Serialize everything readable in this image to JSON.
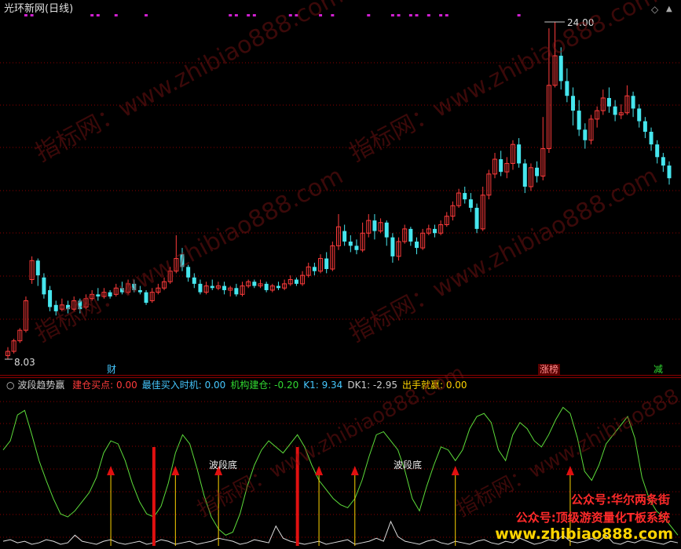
{
  "chart": {
    "title": "光环新网(日线)",
    "price_high_label": "24.00",
    "price_low_label": "8.03",
    "markers": {
      "cai": "财",
      "zhangbang": "涨榜",
      "jian": "减"
    },
    "icons": {
      "diamond": "◇",
      "up": "▲"
    }
  },
  "indicator": {
    "name": "波段趋势赢",
    "items": [
      {
        "label": "建仓买点:",
        "value": "0.00",
        "color": "#ff3b3b"
      },
      {
        "label": "最佳买入时机:",
        "value": "0.00",
        "color": "#46c8ff"
      },
      {
        "label": "机构建仓:",
        "value": "-0.20",
        "color": "#31d931"
      },
      {
        "label": "K1:",
        "value": "9.34",
        "color": "#46c8ff"
      },
      {
        "label": "DK1:",
        "value": "-2.95",
        "color": "#cccccc"
      },
      {
        "label": "出手就赢:",
        "value": "0.00",
        "color": "#ffd500"
      }
    ],
    "bottom_label": "波段底"
  },
  "watermark": {
    "text": "指标网：www.zhibiao888.com"
  },
  "ads": {
    "line1": "公众号:华尔两条街",
    "line2": "公众号:顶级游资量化T板系统",
    "url": "www.zhibiao888.com"
  },
  "colors": {
    "up": "#ff3b3b",
    "down": "#46e6ee",
    "grid": "#8b0000",
    "magenta": "#d020d0",
    "green_line": "#5ddc3a",
    "white_line": "#dddddd",
    "yellow": "#ffd500",
    "red_bar": "#e01010"
  },
  "chart_data": {
    "type": "candlestick",
    "price_range": [
      8.03,
      24.0
    ],
    "candles": [
      {
        "o": 8.2,
        "c": 8.4,
        "h": 8.6,
        "l": 8.03
      },
      {
        "o": 8.4,
        "c": 8.9,
        "h": 9.0,
        "l": 8.3
      },
      {
        "o": 8.9,
        "c": 9.4,
        "h": 9.5,
        "l": 8.8
      },
      {
        "o": 9.4,
        "c": 10.8,
        "h": 11.0,
        "l": 9.3
      },
      {
        "o": 11.8,
        "c": 12.7,
        "h": 12.9,
        "l": 11.6
      },
      {
        "o": 12.7,
        "c": 12.0,
        "h": 12.8,
        "l": 11.5
      },
      {
        "o": 11.9,
        "c": 11.1,
        "h": 12.1,
        "l": 10.9
      },
      {
        "o": 11.3,
        "c": 10.5,
        "h": 11.5,
        "l": 10.3
      },
      {
        "o": 10.6,
        "c": 10.3,
        "h": 10.8,
        "l": 10.1
      },
      {
        "o": 10.4,
        "c": 10.6,
        "h": 10.9,
        "l": 10.3
      },
      {
        "o": 10.6,
        "c": 10.4,
        "h": 10.8,
        "l": 10.2
      },
      {
        "o": 10.4,
        "c": 10.8,
        "h": 11.0,
        "l": 10.3
      },
      {
        "o": 10.8,
        "c": 10.4,
        "h": 10.9,
        "l": 10.2
      },
      {
        "o": 10.5,
        "c": 10.9,
        "h": 11.1,
        "l": 10.4
      },
      {
        "o": 10.9,
        "c": 11.1,
        "h": 11.3,
        "l": 10.8
      },
      {
        "o": 11.1,
        "c": 11.0,
        "h": 11.4,
        "l": 10.8
      },
      {
        "o": 11.0,
        "c": 11.2,
        "h": 11.4,
        "l": 10.9
      },
      {
        "o": 11.2,
        "c": 11.0,
        "h": 11.3,
        "l": 10.9
      },
      {
        "o": 11.1,
        "c": 11.4,
        "h": 11.6,
        "l": 11.0
      },
      {
        "o": 11.4,
        "c": 11.2,
        "h": 11.7,
        "l": 11.1
      },
      {
        "o": 11.2,
        "c": 11.6,
        "h": 11.8,
        "l": 11.1
      },
      {
        "o": 11.6,
        "c": 11.3,
        "h": 11.8,
        "l": 11.2
      },
      {
        "o": 11.3,
        "c": 11.2,
        "h": 11.5,
        "l": 11.1
      },
      {
        "o": 11.2,
        "c": 10.7,
        "h": 11.3,
        "l": 10.6
      },
      {
        "o": 10.8,
        "c": 11.2,
        "h": 11.4,
        "l": 10.7
      },
      {
        "o": 11.2,
        "c": 11.4,
        "h": 11.6,
        "l": 11.1
      },
      {
        "o": 11.4,
        "c": 11.7,
        "h": 11.9,
        "l": 11.3
      },
      {
        "o": 11.7,
        "c": 12.2,
        "h": 12.4,
        "l": 11.6
      },
      {
        "o": 12.2,
        "c": 12.8,
        "h": 13.9,
        "l": 12.1
      },
      {
        "o": 13.0,
        "c": 12.4,
        "h": 13.3,
        "l": 12.2
      },
      {
        "o": 12.4,
        "c": 11.9,
        "h": 12.5,
        "l": 11.7
      },
      {
        "o": 11.9,
        "c": 11.6,
        "h": 12.1,
        "l": 11.4
      },
      {
        "o": 11.6,
        "c": 11.2,
        "h": 11.8,
        "l": 11.1
      },
      {
        "o": 11.2,
        "c": 11.5,
        "h": 11.7,
        "l": 11.1
      },
      {
        "o": 11.5,
        "c": 11.4,
        "h": 11.8,
        "l": 11.3
      },
      {
        "o": 11.4,
        "c": 11.5,
        "h": 11.7,
        "l": 11.3
      },
      {
        "o": 11.5,
        "c": 11.3,
        "h": 11.7,
        "l": 11.1
      },
      {
        "o": 11.3,
        "c": 11.4,
        "h": 11.5,
        "l": 11.0
      },
      {
        "o": 11.4,
        "c": 11.1,
        "h": 11.6,
        "l": 11.0
      },
      {
        "o": 11.1,
        "c": 11.5,
        "h": 11.7,
        "l": 11.0
      },
      {
        "o": 11.5,
        "c": 11.7,
        "h": 11.8,
        "l": 11.4
      },
      {
        "o": 11.7,
        "c": 11.5,
        "h": 11.8,
        "l": 11.4
      },
      {
        "o": 11.5,
        "c": 11.6,
        "h": 11.8,
        "l": 11.4
      },
      {
        "o": 11.6,
        "c": 11.3,
        "h": 11.7,
        "l": 11.2
      },
      {
        "o": 11.3,
        "c": 11.5,
        "h": 11.6,
        "l": 11.2
      },
      {
        "o": 11.5,
        "c": 11.4,
        "h": 11.7,
        "l": 11.3
      },
      {
        "o": 11.4,
        "c": 11.6,
        "h": 11.8,
        "l": 11.3
      },
      {
        "o": 11.6,
        "c": 11.8,
        "h": 12.0,
        "l": 11.5
      },
      {
        "o": 11.8,
        "c": 11.6,
        "h": 11.9,
        "l": 11.5
      },
      {
        "o": 11.6,
        "c": 12.0,
        "h": 12.2,
        "l": 11.5
      },
      {
        "o": 12.0,
        "c": 12.4,
        "h": 12.6,
        "l": 11.9
      },
      {
        "o": 12.4,
        "c": 12.2,
        "h": 12.6,
        "l": 12.0
      },
      {
        "o": 12.2,
        "c": 12.8,
        "h": 13.0,
        "l": 12.1
      },
      {
        "o": 12.8,
        "c": 12.3,
        "h": 13.1,
        "l": 12.1
      },
      {
        "o": 12.3,
        "c": 13.4,
        "h": 13.6,
        "l": 12.2
      },
      {
        "o": 13.4,
        "c": 14.3,
        "h": 14.9,
        "l": 13.2
      },
      {
        "o": 14.1,
        "c": 13.6,
        "h": 14.4,
        "l": 13.4
      },
      {
        "o": 13.6,
        "c": 13.4,
        "h": 13.9,
        "l": 13.1
      },
      {
        "o": 13.4,
        "c": 13.2,
        "h": 13.7,
        "l": 13.0
      },
      {
        "o": 13.2,
        "c": 14.0,
        "h": 14.5,
        "l": 13.1
      },
      {
        "o": 14.0,
        "c": 14.6,
        "h": 14.9,
        "l": 13.8
      },
      {
        "o": 14.6,
        "c": 14.1,
        "h": 14.9,
        "l": 13.7
      },
      {
        "o": 14.1,
        "c": 14.5,
        "h": 14.7,
        "l": 14.0
      },
      {
        "o": 14.5,
        "c": 13.8,
        "h": 14.6,
        "l": 13.4
      },
      {
        "o": 13.8,
        "c": 12.9,
        "h": 14.0,
        "l": 12.6
      },
      {
        "o": 12.9,
        "c": 13.6,
        "h": 13.8,
        "l": 12.7
      },
      {
        "o": 13.6,
        "c": 14.2,
        "h": 14.4,
        "l": 13.5
      },
      {
        "o": 14.2,
        "c": 13.6,
        "h": 14.3,
        "l": 13.4
      },
      {
        "o": 13.6,
        "c": 13.3,
        "h": 13.8,
        "l": 13.0
      },
      {
        "o": 13.3,
        "c": 14.0,
        "h": 14.2,
        "l": 13.2
      },
      {
        "o": 14.0,
        "c": 14.2,
        "h": 14.4,
        "l": 13.9
      },
      {
        "o": 14.2,
        "c": 14.0,
        "h": 14.4,
        "l": 13.8
      },
      {
        "o": 14.0,
        "c": 14.4,
        "h": 14.6,
        "l": 13.9
      },
      {
        "o": 14.4,
        "c": 14.8,
        "h": 15.0,
        "l": 14.3
      },
      {
        "o": 14.8,
        "c": 15.3,
        "h": 15.5,
        "l": 14.6
      },
      {
        "o": 15.3,
        "c": 15.9,
        "h": 16.1,
        "l": 15.2
      },
      {
        "o": 15.9,
        "c": 15.6,
        "h": 16.2,
        "l": 15.4
      },
      {
        "o": 15.6,
        "c": 15.2,
        "h": 15.9,
        "l": 15.0
      },
      {
        "o": 15.2,
        "c": 14.2,
        "h": 15.4,
        "l": 14.0
      },
      {
        "o": 14.2,
        "c": 15.8,
        "h": 16.2,
        "l": 14.1
      },
      {
        "o": 15.8,
        "c": 16.8,
        "h": 17.0,
        "l": 15.6
      },
      {
        "o": 16.8,
        "c": 17.5,
        "h": 17.8,
        "l": 16.6
      },
      {
        "o": 17.5,
        "c": 16.9,
        "h": 17.9,
        "l": 16.7
      },
      {
        "o": 16.9,
        "c": 17.3,
        "h": 17.6,
        "l": 16.6
      },
      {
        "o": 17.3,
        "c": 18.2,
        "h": 18.4,
        "l": 17.0
      },
      {
        "o": 18.2,
        "c": 17.3,
        "h": 18.5,
        "l": 17.1
      },
      {
        "o": 17.3,
        "c": 16.2,
        "h": 17.5,
        "l": 15.9
      },
      {
        "o": 16.2,
        "c": 17.1,
        "h": 17.3,
        "l": 16.0
      },
      {
        "o": 17.1,
        "c": 16.7,
        "h": 17.4,
        "l": 16.4
      },
      {
        "o": 16.7,
        "c": 18.0,
        "h": 19.5,
        "l": 16.5
      },
      {
        "o": 18.0,
        "c": 21.0,
        "h": 23.7,
        "l": 17.8
      },
      {
        "o": 21.0,
        "c": 22.4,
        "h": 24.0,
        "l": 20.9
      },
      {
        "o": 22.4,
        "c": 21.2,
        "h": 22.8,
        "l": 20.8
      },
      {
        "o": 21.2,
        "c": 20.5,
        "h": 21.8,
        "l": 20.2
      },
      {
        "o": 20.5,
        "c": 19.8,
        "h": 20.9,
        "l": 19.1
      },
      {
        "o": 19.8,
        "c": 18.9,
        "h": 20.3,
        "l": 18.6
      },
      {
        "o": 18.9,
        "c": 18.4,
        "h": 19.2,
        "l": 18.0
      },
      {
        "o": 18.4,
        "c": 19.4,
        "h": 19.6,
        "l": 18.2
      },
      {
        "o": 19.4,
        "c": 19.8,
        "h": 20.0,
        "l": 19.0
      },
      {
        "o": 19.8,
        "c": 20.4,
        "h": 20.8,
        "l": 19.6
      },
      {
        "o": 20.4,
        "c": 20.0,
        "h": 20.9,
        "l": 19.7
      },
      {
        "o": 20.0,
        "c": 19.6,
        "h": 20.3,
        "l": 19.3
      },
      {
        "o": 19.6,
        "c": 19.7,
        "h": 20.1,
        "l": 19.4
      },
      {
        "o": 19.7,
        "c": 20.5,
        "h": 21.0,
        "l": 19.6
      },
      {
        "o": 20.5,
        "c": 19.9,
        "h": 20.7,
        "l": 19.5
      },
      {
        "o": 19.9,
        "c": 19.3,
        "h": 20.1,
        "l": 19.0
      },
      {
        "o": 19.3,
        "c": 18.8,
        "h": 19.5,
        "l": 18.5
      },
      {
        "o": 18.8,
        "c": 18.2,
        "h": 19.0,
        "l": 17.9
      },
      {
        "o": 18.2,
        "c": 17.6,
        "h": 18.4,
        "l": 17.3
      },
      {
        "o": 17.6,
        "c": 17.2,
        "h": 17.8,
        "l": 16.9
      },
      {
        "o": 17.2,
        "c": 16.6,
        "h": 17.4,
        "l": 16.3
      }
    ],
    "green_line": [
      0.62,
      0.68,
      0.85,
      0.88,
      0.72,
      0.55,
      0.42,
      0.3,
      0.2,
      0.18,
      0.22,
      0.28,
      0.34,
      0.44,
      0.6,
      0.68,
      0.66,
      0.55,
      0.4,
      0.28,
      0.2,
      0.18,
      0.25,
      0.4,
      0.6,
      0.72,
      0.66,
      0.5,
      0.32,
      0.18,
      0.1,
      0.06,
      0.08,
      0.2,
      0.38,
      0.52,
      0.62,
      0.68,
      0.64,
      0.6,
      0.66,
      0.72,
      0.64,
      0.52,
      0.42,
      0.36,
      0.3,
      0.26,
      0.24,
      0.3,
      0.42,
      0.58,
      0.72,
      0.74,
      0.68,
      0.62,
      0.48,
      0.3,
      0.22,
      0.38,
      0.52,
      0.64,
      0.62,
      0.55,
      0.62,
      0.76,
      0.84,
      0.86,
      0.8,
      0.62,
      0.55,
      0.72,
      0.8,
      0.76,
      0.68,
      0.64,
      0.72,
      0.82,
      0.9,
      0.86,
      0.7,
      0.48,
      0.42,
      0.52,
      0.66,
      0.72,
      0.78,
      0.84,
      0.7,
      0.44,
      0.3,
      0.22,
      0.18,
      0.12,
      0.06
    ],
    "white_line": [
      0.02,
      0.03,
      0.01,
      0.02,
      0.0,
      0.01,
      0.03,
      0.02,
      0.0,
      0.01,
      0.06,
      0.02,
      0.01,
      0.0,
      0.02,
      0.03,
      0.01,
      0.0,
      0.01,
      0.02,
      0.0,
      0.01,
      0.03,
      0.02,
      0.0,
      0.01,
      0.02,
      0.0,
      0.01,
      0.02,
      0.04,
      0.03,
      0.02,
      0.0,
      0.01,
      0.03,
      0.02,
      0.01,
      0.12,
      0.04,
      0.02,
      0.01,
      0.0,
      0.01,
      0.02,
      0.0,
      0.01,
      0.02,
      0.03,
      0.0,
      0.01,
      0.02,
      0.04,
      0.02,
      0.15,
      0.05,
      0.02,
      0.01,
      0.0,
      0.02,
      0.03,
      0.01,
      0.0,
      0.02,
      0.01,
      0.0,
      0.02,
      0.03,
      0.01,
      0.0,
      0.02,
      0.01,
      0.04,
      0.02,
      0.0,
      0.01,
      0.03,
      0.02,
      0.06,
      0.02,
      0.01,
      0.02,
      0.04,
      0.02,
      0.06,
      0.01,
      0.0,
      0.02,
      0.01,
      0.03,
      0.02,
      0.01,
      0.0,
      0.02,
      0.01
    ],
    "buy_arrows_x_index": [
      15,
      24,
      30,
      44,
      49,
      63,
      79
    ],
    "wave_bottom_x_index": [
      21,
      41
    ]
  },
  "top_markers": {
    "magenta_dots_x_index": [
      3,
      4,
      14,
      15,
      18,
      23,
      37,
      38,
      40,
      41,
      47,
      48,
      52,
      54,
      60,
      64,
      65,
      67,
      68,
      70,
      72,
      73,
      85
    ]
  }
}
